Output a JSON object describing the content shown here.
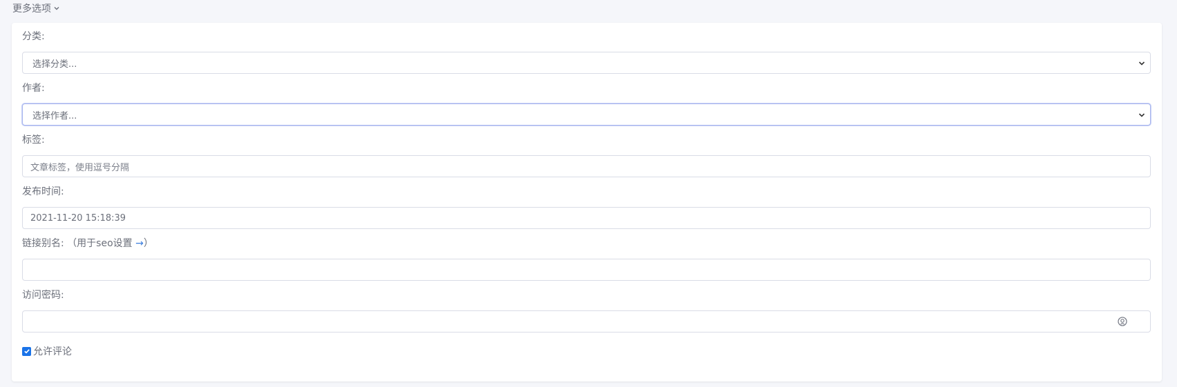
{
  "toggle": {
    "label": "更多选项"
  },
  "category": {
    "label": "分类:",
    "value": "选择分类..."
  },
  "author": {
    "label": "作者:",
    "value": "选择作者..."
  },
  "tags": {
    "label": "标签:",
    "placeholder": "文章标签，使用逗号分隔"
  },
  "publish_time": {
    "label": "发布时间:",
    "value": "2021-11-20 15:18:39"
  },
  "slug": {
    "label": "链接别名:",
    "hint_prefix": "（用于seo设置 ",
    "hint_arrow": "→",
    "hint_suffix": "）",
    "value": ""
  },
  "password": {
    "label": "访问密码:",
    "value": ""
  },
  "allow_comments": {
    "label": "允许评论",
    "checked": true
  },
  "colors": {
    "accent": "#1a73e8",
    "border": "#d9dce6",
    "focus": "#a9b6ee",
    "background": "#f5f6fa"
  },
  "icons": {
    "toggle": "chevron-down-icon",
    "select": "chevron-down-icon",
    "password": "eye-icon"
  }
}
